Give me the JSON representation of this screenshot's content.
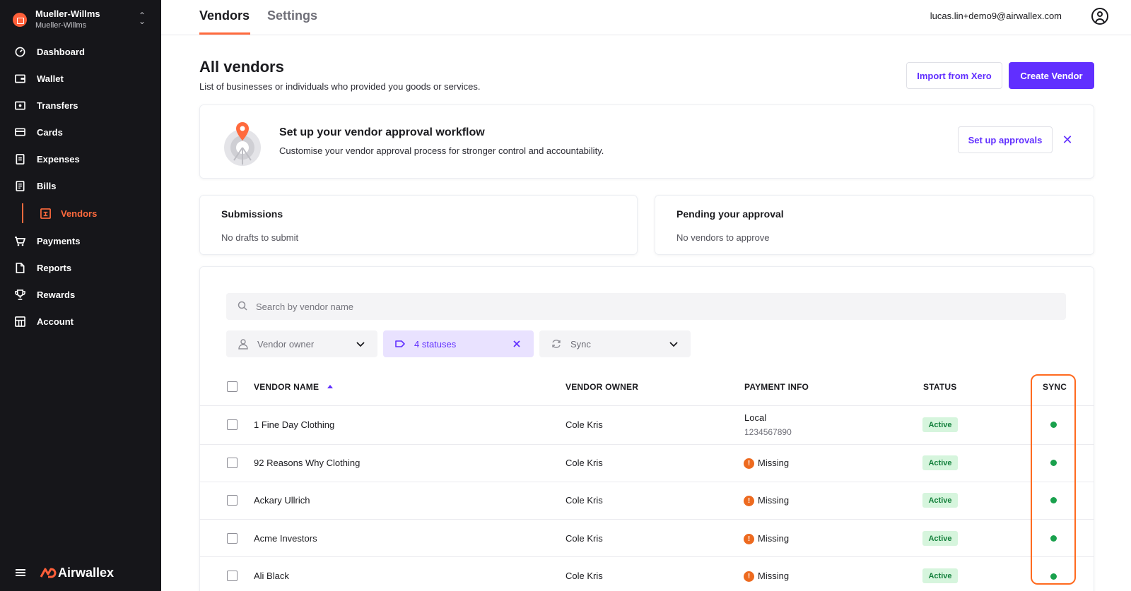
{
  "org": {
    "name": "Mueller-Willms",
    "sub": "Mueller-Willms"
  },
  "nav": {
    "dashboard": "Dashboard",
    "wallet": "Wallet",
    "transfers": "Transfers",
    "cards": "Cards",
    "expenses": "Expenses",
    "bills": "Bills",
    "vendors": "Vendors",
    "payments": "Payments",
    "reports": "Reports",
    "rewards": "Rewards",
    "account": "Account"
  },
  "brand": "Airwallex",
  "tabs": {
    "vendors": "Vendors",
    "settings": "Settings"
  },
  "user": {
    "email": "lucas.lin+demo9@airwallex.com"
  },
  "header": {
    "title": "All vendors",
    "subtitle": "List of businesses or individuals who provided you goods or services.",
    "import_label": "Import from Xero",
    "create_label": "Create Vendor"
  },
  "banner": {
    "title": "Set up your vendor approval workflow",
    "text": "Customise your vendor approval process for stronger control and accountability.",
    "button": "Set up approvals"
  },
  "cards": {
    "submissions_title": "Submissions",
    "submissions_text": "No drafts to submit",
    "pending_title": "Pending your approval",
    "pending_text": "No vendors to approve"
  },
  "search": {
    "placeholder": "Search by vendor name"
  },
  "filters": {
    "owner": "Vendor owner",
    "statuses": "4 statuses",
    "sync": "Sync"
  },
  "table": {
    "headers": {
      "vendor_name": "VENDOR NAME",
      "vendor_owner": "VENDOR OWNER",
      "payment_info": "PAYMENT INFO",
      "status": "STATUS",
      "sync": "SYNC"
    },
    "rows": [
      {
        "name": "1 Fine Day Clothing",
        "owner": "Cole Kris",
        "payment": "Local",
        "payment_detail": "1234567890",
        "status": "Active"
      },
      {
        "name": "92 Reasons Why Clothing",
        "owner": "Cole Kris",
        "payment": "Missing",
        "status": "Active"
      },
      {
        "name": "Ackary Ullrich",
        "owner": "Cole Kris",
        "payment": "Missing",
        "status": "Active"
      },
      {
        "name": "Acme Investors",
        "owner": "Cole Kris",
        "payment": "Missing",
        "status": "Active"
      },
      {
        "name": "Ali Black",
        "owner": "Cole Kris",
        "payment": "Missing",
        "status": "Active"
      }
    ]
  },
  "colors": {
    "accent": "#612fff",
    "brand_orange": "#ff6a3d",
    "sidebar_bg": "#16161a",
    "status_active_bg": "#d6f5dd",
    "sync_ok": "#1aa14d",
    "missing": "#ed6a1f",
    "highlight": "#ff6a1f"
  }
}
